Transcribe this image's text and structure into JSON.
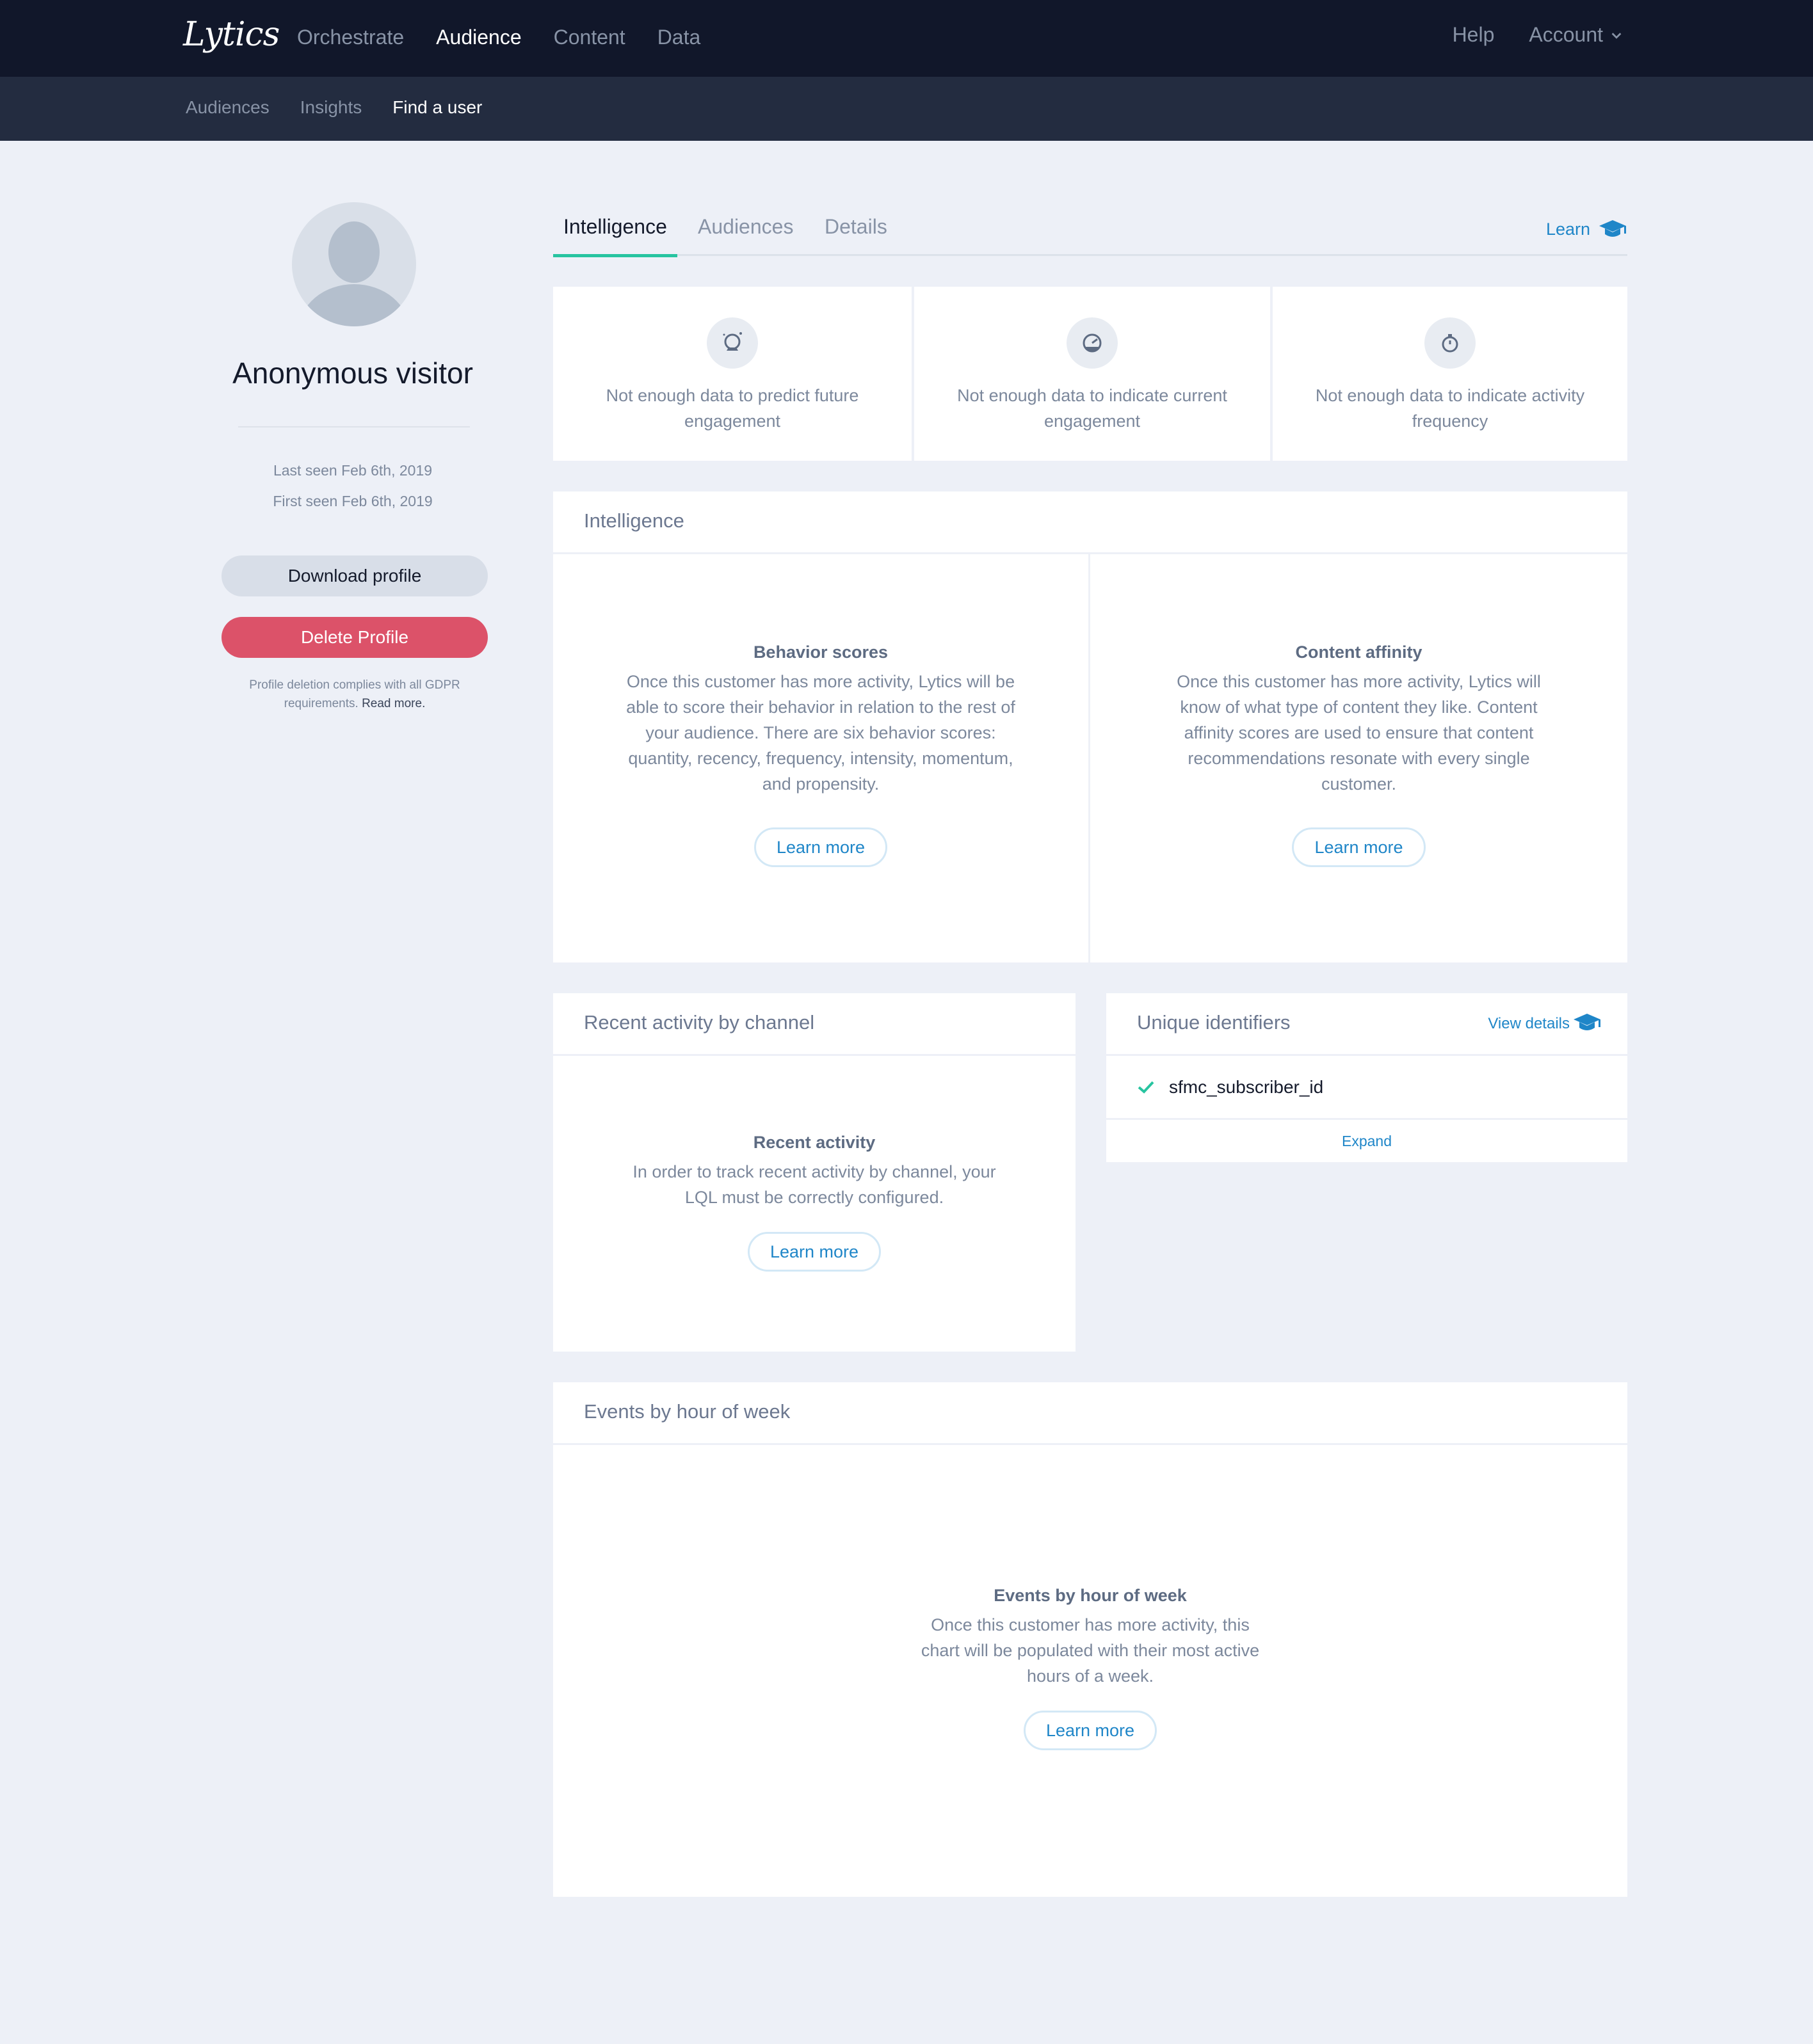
{
  "app": {
    "logo": "Lytics",
    "nav_main": [
      "Orchestrate",
      "Audience",
      "Content",
      "Data"
    ],
    "nav_right": {
      "help": "Help",
      "account": "Account"
    },
    "subnav": [
      "Audiences",
      "Insights",
      "Find a user"
    ]
  },
  "profile": {
    "name": "Anonymous visitor",
    "last_seen": "Last seen Feb 6th, 2019",
    "first_seen": "First seen Feb 6th, 2019",
    "download_label": "Download profile",
    "delete_label": "Delete Profile",
    "gdpr_text": "Profile deletion complies with all GDPR requirements.",
    "gdpr_link": "Read more."
  },
  "tabs": {
    "items": [
      "Intelligence",
      "Audiences",
      "Details"
    ],
    "active": "Intelligence",
    "learn": "Learn"
  },
  "stats": [
    {
      "icon": "crystal-ball-icon",
      "text": "Not enough data to predict future engagement"
    },
    {
      "icon": "gauge-icon",
      "text": "Not enough data to indicate current engagement"
    },
    {
      "icon": "stopwatch-icon",
      "text": "Not enough data to indicate activity frequency"
    }
  ],
  "intelligence": {
    "header": "Intelligence",
    "behavior": {
      "title": "Behavior scores",
      "body": "Once this customer has more activity, Lytics will be able to score their behavior in relation to the rest of your audience. There are six behavior scores: quantity, recency, frequency, intensity, momentum, and propensity.",
      "button": "Learn more"
    },
    "affinity": {
      "title": "Content affinity",
      "body": "Once this customer has more activity, Lytics will know of what type of content they like. Content affinity scores are used to ensure that content recommendations resonate with every single customer.",
      "button": "Learn more"
    }
  },
  "recent_activity": {
    "header": "Recent activity by channel",
    "title": "Recent activity",
    "body": "In order to track recent activity by channel, your LQL must be correctly configured.",
    "button": "Learn more"
  },
  "unique_identifiers": {
    "header": "Unique identifiers",
    "view_details": "View details",
    "items": [
      "sfmc_subscriber_id"
    ],
    "expand": "Expand"
  },
  "events": {
    "header": "Events by hour of week",
    "title": "Events by hour of week",
    "body": "Once this customer has more activity, this chart will be populated with their most active hours of a week.",
    "button": "Learn more"
  },
  "colors": {
    "accent": "#1f86c8",
    "delete": "#dc5269",
    "tab_indicator": "#27c4a0",
    "check": "#27c4a0"
  }
}
